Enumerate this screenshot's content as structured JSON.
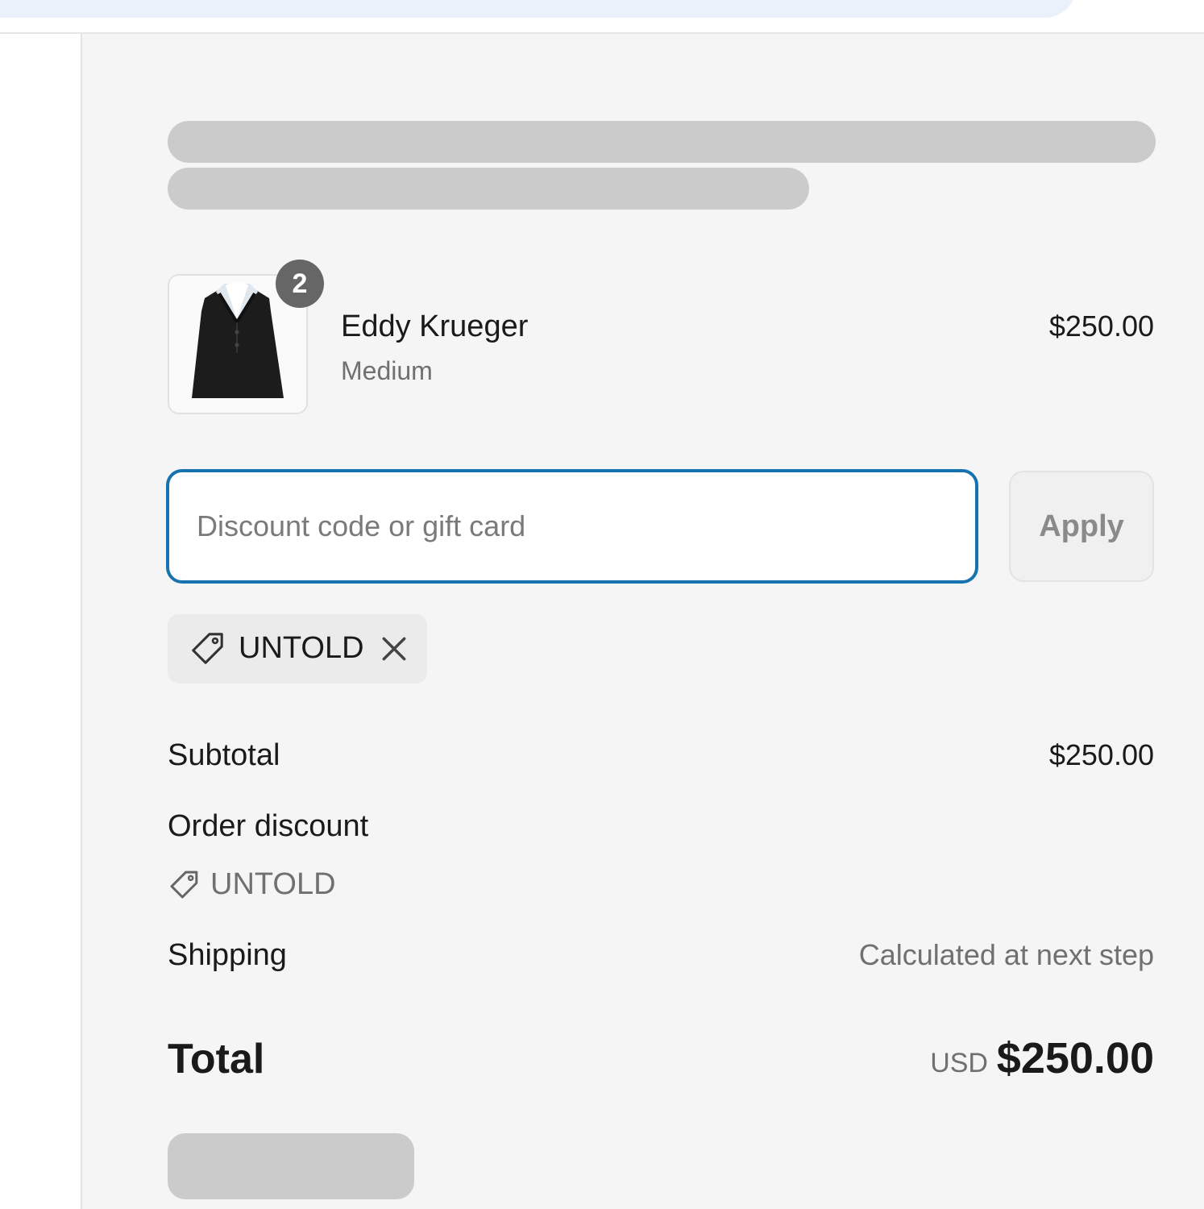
{
  "order_summary": {
    "item": {
      "name": "Eddy Krueger",
      "variant": "Medium",
      "price": "$250.00",
      "quantity": "2"
    },
    "discount": {
      "placeholder": "Discount code or gift card",
      "value": "",
      "apply_label": "Apply",
      "applied_code": "UNTOLD"
    },
    "subtotal": {
      "label": "Subtotal",
      "value": "$250.00"
    },
    "order_discount": {
      "label": "Order discount",
      "code": "UNTOLD"
    },
    "shipping": {
      "label": "Shipping",
      "value": "Calculated at next step"
    },
    "total": {
      "label": "Total",
      "currency": "USD",
      "value": "$250.00"
    }
  },
  "colors": {
    "accent": "#1773b0",
    "panel_bg": "#f5f5f5",
    "skeleton": "#cbcbcb",
    "badge_bg": "#666666"
  },
  "icons": {
    "tag": "tag-icon",
    "remove": "close-icon"
  }
}
